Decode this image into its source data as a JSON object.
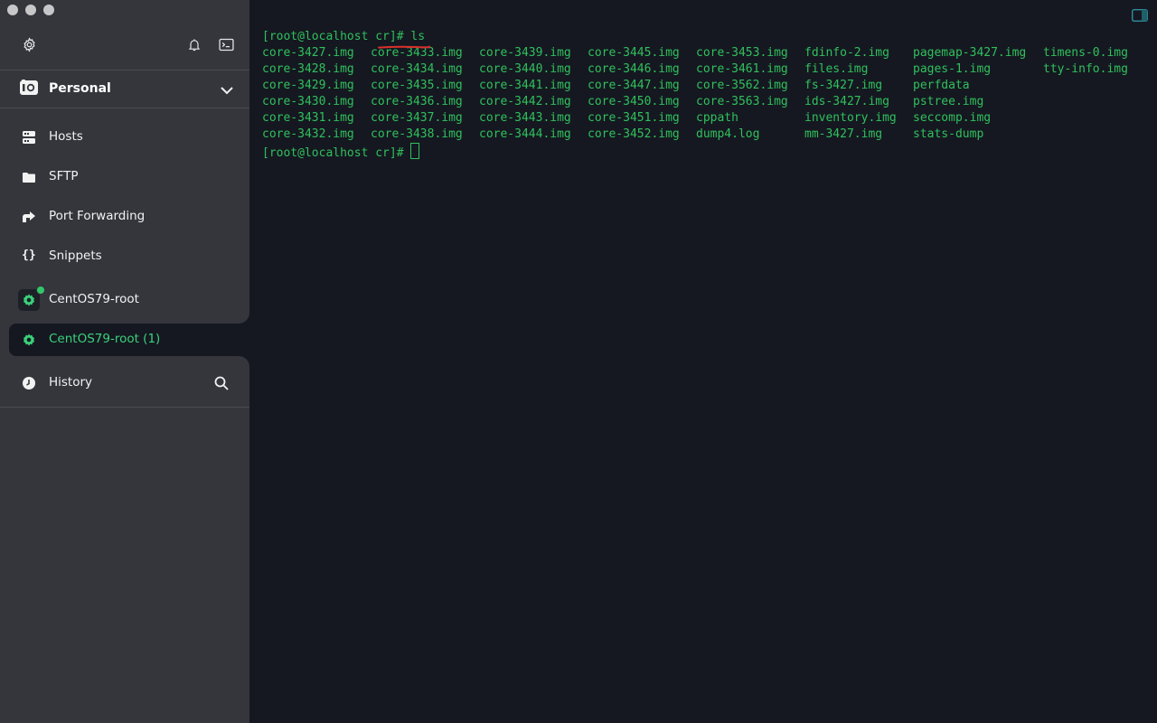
{
  "sidebar": {
    "vault": {
      "label": "Personal"
    },
    "nav": [
      {
        "label": "Hosts",
        "icon": "hosts-icon"
      },
      {
        "label": "SFTP",
        "icon": "folder-icon"
      },
      {
        "label": "Port Forwarding",
        "icon": "port-forwarding-icon"
      },
      {
        "label": "Snippets",
        "icon": "snippets-icon"
      }
    ],
    "sessions": [
      {
        "label": "CentOS79-root",
        "status": "online",
        "icon": "host-gear-icon"
      },
      {
        "label": "CentOS79-root (1)",
        "active": true,
        "icon": "host-gear-icon"
      }
    ],
    "history": {
      "label": "History"
    }
  },
  "terminal": {
    "prompt1": "[root@localhost cr]#",
    "command1": " ls",
    "listing": [
      [
        "core-3427.img",
        "core-3433.img",
        "core-3439.img",
        "core-3445.img",
        "core-3453.img",
        "fdinfo-2.img",
        "pagemap-3427.img",
        "timens-0.img"
      ],
      [
        "core-3428.img",
        "core-3434.img",
        "core-3440.img",
        "core-3446.img",
        "core-3461.img",
        "files.img",
        "pages-1.img",
        "tty-info.img"
      ],
      [
        "core-3429.img",
        "core-3435.img",
        "core-3441.img",
        "core-3447.img",
        "core-3562.img",
        "fs-3427.img",
        "perfdata",
        ""
      ],
      [
        "core-3430.img",
        "core-3436.img",
        "core-3442.img",
        "core-3450.img",
        "core-3563.img",
        "ids-3427.img",
        "pstree.img",
        ""
      ],
      [
        "core-3431.img",
        "core-3437.img",
        "core-3443.img",
        "core-3451.img",
        "cppath",
        "inventory.img",
        "seccomp.img",
        ""
      ],
      [
        "core-3432.img",
        "core-3438.img",
        "core-3444.img",
        "core-3452.img",
        "dump4.log",
        "mm-3427.img",
        "stats-dump",
        ""
      ]
    ],
    "prompt2": "[root@localhost cr]# "
  },
  "colors": {
    "sidebar_bg": "#34363c",
    "terminal_bg": "#151821",
    "terminal_text": "#30c05c",
    "accent_green": "#3bd07a",
    "annotation_red": "#d9312b"
  }
}
